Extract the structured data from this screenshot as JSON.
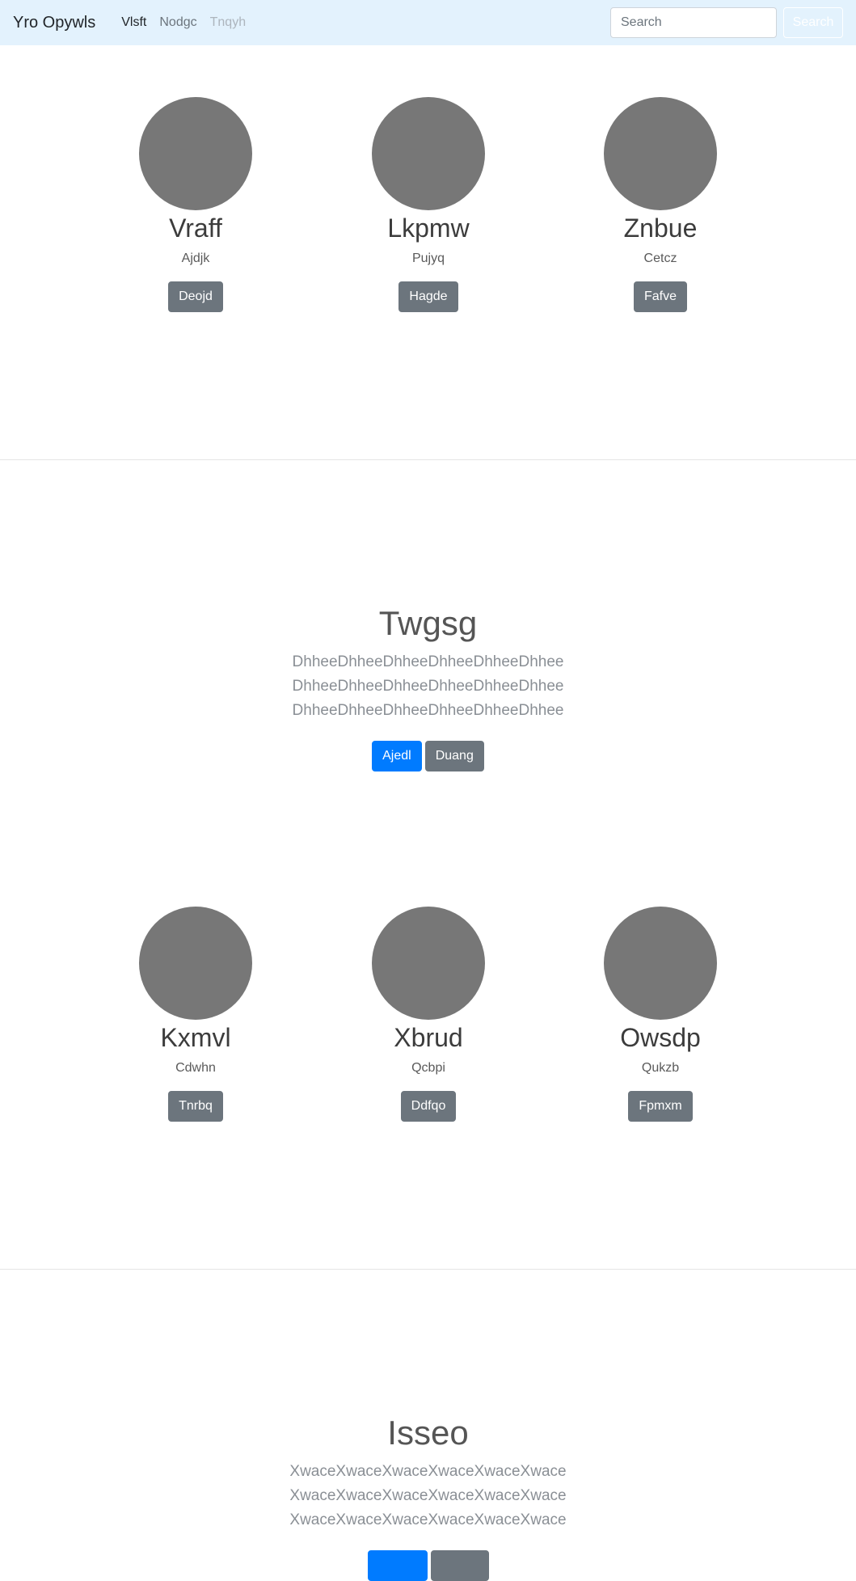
{
  "navbar": {
    "brand": "Yro Opywls",
    "links": [
      {
        "label": "Vlsft",
        "state": "active"
      },
      {
        "label": "Nodgc",
        "state": "normal"
      },
      {
        "label": "Tnqyh",
        "state": "disabled"
      }
    ],
    "search_placeholder": "Search",
    "search_button": "Search"
  },
  "row1": [
    {
      "name": "Vraff",
      "sub": "Ajdjk",
      "button": "Deojd"
    },
    {
      "name": "Lkpmw",
      "sub": "Pujyq",
      "button": "Hagde"
    },
    {
      "name": "Znbue",
      "sub": "Cetcz",
      "button": "Fafve"
    }
  ],
  "section1": {
    "title": "Twgsg",
    "lines": [
      "DhheeDhheeDhheeDhheeDhheeDhhee",
      "DhheeDhheeDhheeDhheeDhheeDhhee",
      "DhheeDhheeDhheeDhheeDhheeDhhee"
    ],
    "primary_button": "Ajedl",
    "secondary_button": "Duang"
  },
  "row2": [
    {
      "name": "Kxmvl",
      "sub": "Cdwhn",
      "button": "Tnrbq"
    },
    {
      "name": "Xbrud",
      "sub": "Qcbpi",
      "button": "Ddfqo"
    },
    {
      "name": "Owsdp",
      "sub": "Qukzb",
      "button": "Fpmxm"
    }
  ],
  "section2": {
    "title": "Isseo",
    "lines": [
      "XwaceXwaceXwaceXwaceXwaceXwace",
      "XwaceXwaceXwaceXwaceXwaceXwace",
      "XwaceXwaceXwaceXwaceXwaceXwace"
    ],
    "primary_button": "",
    "secondary_button": ""
  },
  "colors": {
    "navbar_bg": "#e3f2fd",
    "avatar": "#777777",
    "btn_secondary": "#6c757d",
    "btn_primary": "#007bff"
  }
}
